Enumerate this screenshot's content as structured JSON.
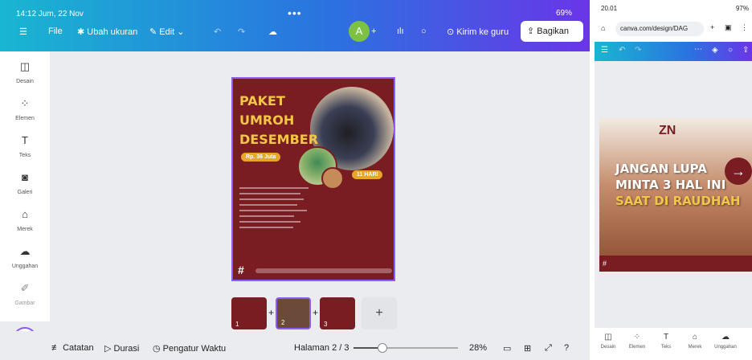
{
  "tablet": {
    "status": {
      "time": "14:12 Jum, 22 Nov",
      "battery": "69%"
    },
    "toolbar": {
      "file": "File",
      "resize": "Ubah ukuran",
      "edit": "Edit",
      "avatar": "A",
      "send_to_teacher": "Kirim ke guru",
      "share": "Bagikan"
    },
    "sidebar": [
      {
        "label": "Desain",
        "icon": "layout-icon"
      },
      {
        "label": "Elemen",
        "icon": "shapes-icon"
      },
      {
        "label": "Teks",
        "icon": "text-icon"
      },
      {
        "label": "Galeri",
        "icon": "camera-icon"
      },
      {
        "label": "Merek",
        "icon": "brand-icon"
      },
      {
        "label": "Unggahan",
        "icon": "cloud-upload-icon"
      },
      {
        "label": "Gambar",
        "icon": "pen-icon"
      }
    ],
    "design": {
      "title_lines": [
        "PAKET",
        "UMROH",
        "DESEMBER"
      ],
      "price": "Rp. 36 Juta",
      "days": "11 HARI",
      "hashtag": "#"
    },
    "pages": [
      {
        "num": "1"
      },
      {
        "num": "2",
        "selected": true
      },
      {
        "num": "3"
      }
    ],
    "bottom": {
      "notes": "Catatan",
      "duration": "Durasi",
      "timer": "Pengatur Waktu",
      "page_indicator": "Halaman 2 / 3",
      "zoom": "28%",
      "zoom_fraction": 0.28
    }
  },
  "phone": {
    "status": {
      "time": "20.01",
      "battery": "97%"
    },
    "url": "canva.com/design/DAG",
    "design": {
      "logo": "ZN",
      "line1": "JANGAN LUPA",
      "line2": "MINTA 3 HAL INI",
      "line3": "SAAT DI RAUDHAH",
      "hashtag": "#"
    },
    "bottom_nav": [
      {
        "label": "Desain"
      },
      {
        "label": "Elemen"
      },
      {
        "label": "Teks"
      },
      {
        "label": "Merek"
      },
      {
        "label": "Unggahan"
      }
    ]
  },
  "colors": {
    "accent": "#8b5cf6",
    "maroon": "#7a1d22",
    "gold": "#f3c64a"
  }
}
